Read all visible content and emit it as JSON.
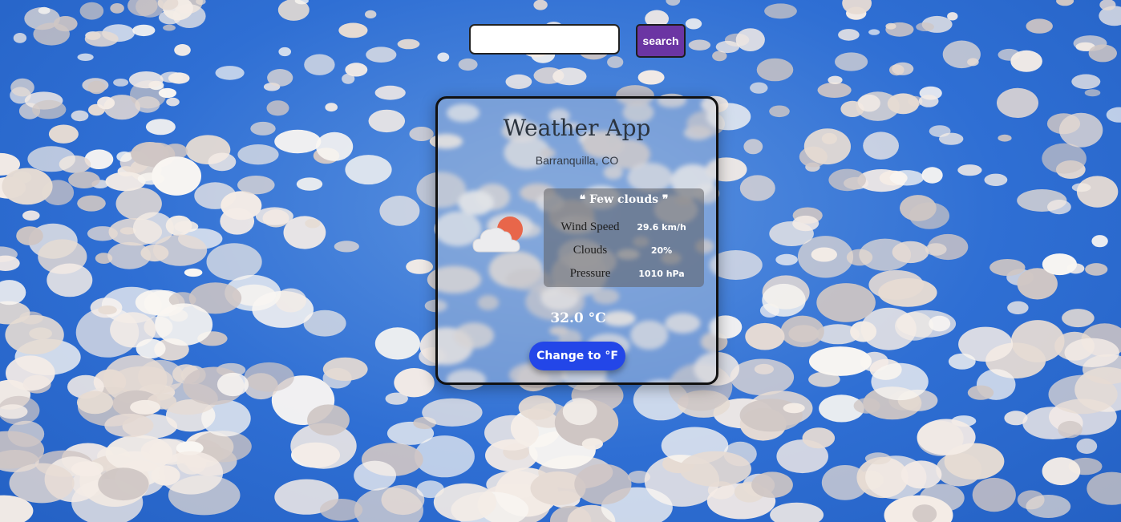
{
  "search": {
    "value": "",
    "placeholder": "",
    "button_label": "search"
  },
  "card": {
    "title": "Weather App",
    "location": "Barranquilla, CO",
    "icon": "few-clouds-day-icon",
    "description": "❝ Few clouds ❞",
    "details": [
      {
        "label": "Wind Speed",
        "value": "29.6 km/h"
      },
      {
        "label": "Clouds",
        "value": "20%"
      },
      {
        "label": "Pressure",
        "value": "1010 hPa"
      }
    ],
    "temperature": "32.0 °C",
    "unit_button_label": "Change to °F"
  },
  "colors": {
    "search_button": "#6b35a3",
    "unit_button": "#2346e8",
    "sun": "#e8664a",
    "sky": "#2f6fd4"
  }
}
